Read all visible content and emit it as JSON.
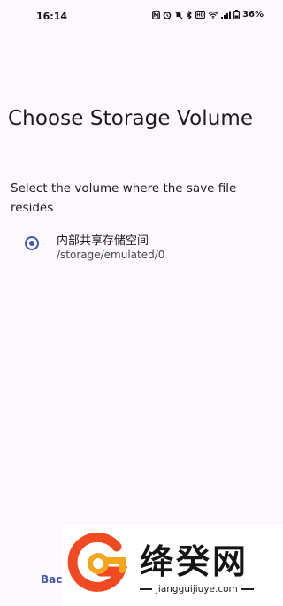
{
  "status_bar": {
    "time": "16:14",
    "battery": "36%",
    "icons": [
      "nfc-icon",
      "alarm-icon",
      "mute-icon",
      "bluetooth-icon",
      "hd-icon",
      "wifi-icon",
      "signal-icon",
      "battery-icon"
    ]
  },
  "screen": {
    "title": "Choose Storage Volume",
    "instruction": "Select the volume where the save file resides"
  },
  "volumes": [
    {
      "name": "内部共享存储空间",
      "path": "/storage/emulated/0",
      "selected": true
    }
  ],
  "buttons": {
    "back_label": "Back"
  },
  "watermark": {
    "brand": "绛癸网",
    "url": "jiangguijiuye.com"
  },
  "colors": {
    "accent": "#3f5aa6",
    "background": "#fcf8fe"
  }
}
